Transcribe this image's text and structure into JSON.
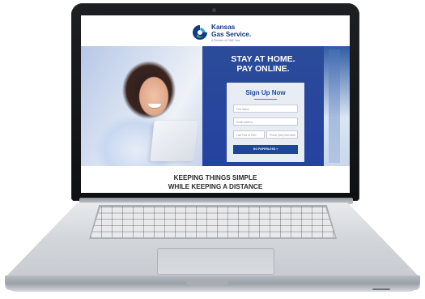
{
  "brand": {
    "name_line1": "Kansas",
    "name_line2": "Gas Service.",
    "tagline": "A Division of ONE Gas",
    "primary_color": "#133b82",
    "accent_color": "#e05a21"
  },
  "hero": {
    "headline_line1": "STAY AT HOME.",
    "headline_line2": "PAY ONLINE.",
    "panel_color": "#2542a0"
  },
  "signup_form": {
    "title": "Sign Up Now",
    "fields": {
      "first_name_placeholder": "First Name",
      "email_placeholder": "Email Address",
      "last4_placeholder": "Last Four of SSN",
      "phone_placeholder": "Phone (###) ###-####"
    },
    "submit_label": "GO PAPERLESS »"
  },
  "footer": {
    "line1": "KEEPING THINGS SIMPLE",
    "line2": "WHILE KEEPING A DISTANCE"
  },
  "icons": {
    "logo": "kansas-gas-flame-logo-icon"
  }
}
